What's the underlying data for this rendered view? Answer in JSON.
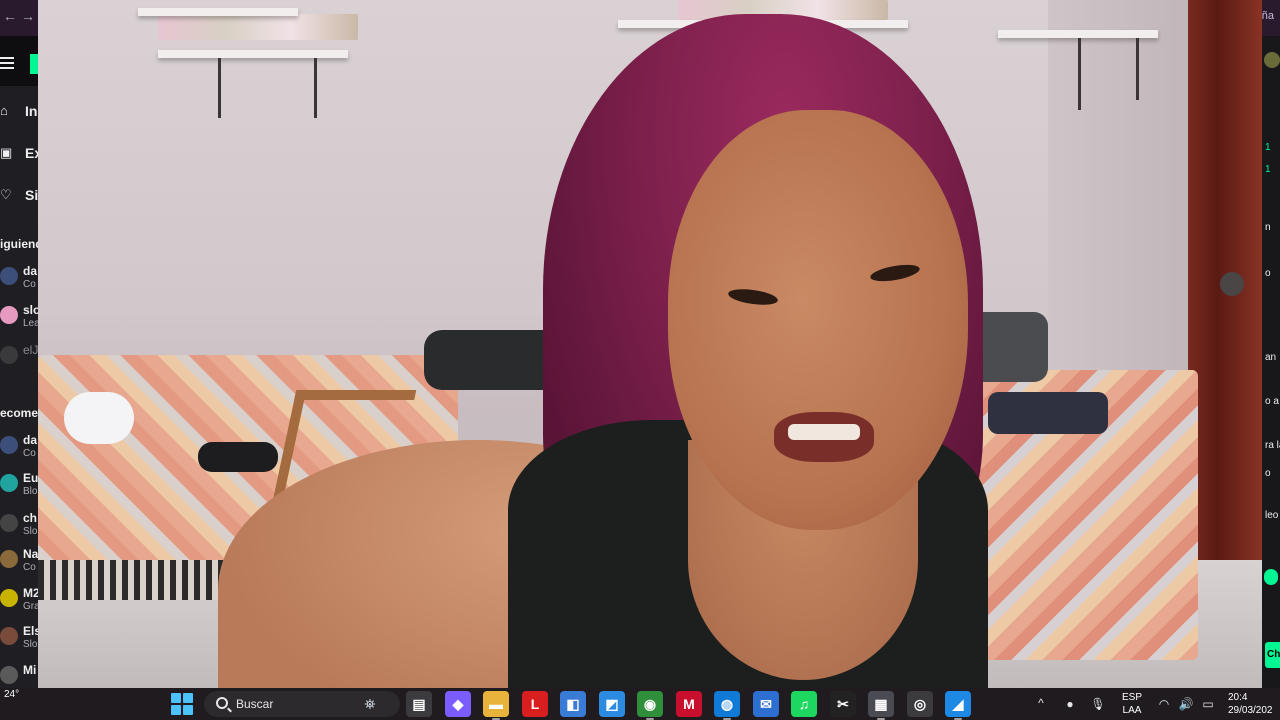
{
  "browser": {
    "back_arrow": "←",
    "forward_arrow": "→",
    "tab_fragment": "ña"
  },
  "left_nav": {
    "items": [
      {
        "icon": "home-icon",
        "glyph": "⌂",
        "label": "In"
      },
      {
        "icon": "browse-icon",
        "glyph": "▣",
        "label": "Ex"
      },
      {
        "icon": "heart-icon",
        "glyph": "♡",
        "label": "Si"
      }
    ],
    "following_title": "iguiendo",
    "following": [
      {
        "name": "da",
        "category": "Co"
      },
      {
        "name": "slo",
        "category": "Lea"
      },
      {
        "name": "elJ",
        "category": ""
      }
    ],
    "recommended_title": "ecomen",
    "recommended": [
      {
        "name": "da",
        "category": "Co"
      },
      {
        "name": "Eu",
        "category": "Blo"
      },
      {
        "name": "ch",
        "category": "Slo"
      },
      {
        "name": "Na",
        "category": "Co"
      },
      {
        "name": "M2",
        "category": "Gra"
      },
      {
        "name": "Els",
        "category": "Slo"
      },
      {
        "name": "Mi",
        "category": ""
      }
    ]
  },
  "right_chat": {
    "lines": [
      {
        "text": "1",
        "green": true
      },
      {
        "text": "1",
        "green": true
      },
      {
        "text": "n",
        "green": false
      },
      {
        "text": "o",
        "green": false
      },
      {
        "text": "an",
        "green": false
      },
      {
        "text": "o a",
        "green": false
      },
      {
        "text": "ra la",
        "green": false
      },
      {
        "text": "o",
        "green": false
      },
      {
        "text": "leo",
        "green": false
      }
    ],
    "chat_button_label": "Ch"
  },
  "taskbar": {
    "weather_temp": "24°",
    "search_placeholder": "Buscar",
    "apps": [
      {
        "name": "task-view-icon",
        "glyph": "▤",
        "color": "#3a3a3f"
      },
      {
        "name": "copilot-icon",
        "glyph": "◆",
        "color": "#7b5cff"
      },
      {
        "name": "file-explorer-icon",
        "glyph": "▬",
        "color": "#e8b33a"
      },
      {
        "name": "lexer-red-icon",
        "glyph": "L",
        "color": "#d81e1e"
      },
      {
        "name": "store-icon",
        "glyph": "◧",
        "color": "#3a7bd5"
      },
      {
        "name": "photo-editor-icon",
        "glyph": "◩",
        "color": "#2a8be0"
      },
      {
        "name": "chrome-icon",
        "glyph": "◉",
        "color": "#2f8f3a"
      },
      {
        "name": "mcafee-icon",
        "glyph": "M",
        "color": "#c8102e"
      },
      {
        "name": "edge-icon",
        "glyph": "◍",
        "color": "#0f7bd7"
      },
      {
        "name": "mail-icon",
        "glyph": "✉",
        "color": "#2d6fd1"
      },
      {
        "name": "spotify-icon",
        "glyph": "♫",
        "color": "#1ed760"
      },
      {
        "name": "capcut-icon",
        "glyph": "✂",
        "color": "#222222"
      },
      {
        "name": "stream-tool-icon",
        "glyph": "▦",
        "color": "#4a4a52"
      },
      {
        "name": "obs-icon",
        "glyph": "◎",
        "color": "#3b3b3f"
      },
      {
        "name": "screenshot-icon",
        "glyph": "◢",
        "color": "#1e88e5"
      }
    ],
    "tray_chevron": "^",
    "tray_icons": [
      {
        "name": "app-tray-icon",
        "glyph": "●"
      },
      {
        "name": "microphone-icon",
        "glyph": "🎙"
      },
      {
        "name": "wifi-icon",
        "glyph": "◠"
      },
      {
        "name": "volume-icon",
        "glyph": "🔊"
      },
      {
        "name": "battery-icon",
        "glyph": "▭"
      }
    ],
    "language_line1": "ESP",
    "language_line2": "LAA",
    "time": "20:4",
    "date": "29/03/202"
  }
}
